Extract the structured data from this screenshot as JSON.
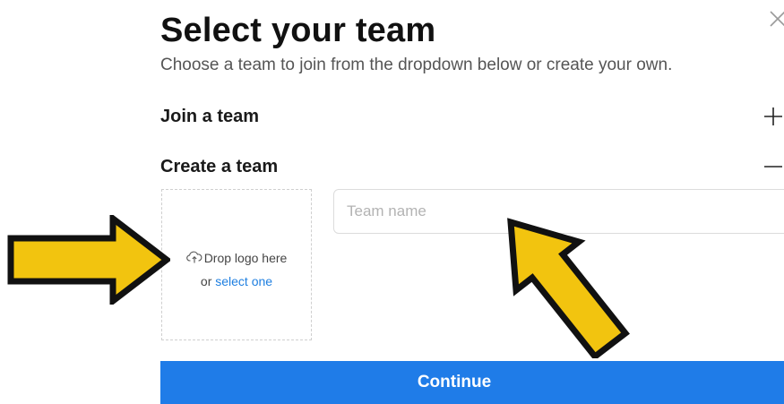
{
  "dialog": {
    "title": "Select your team",
    "subtitle": "Choose a team to join from the dropdown below or create your own."
  },
  "sections": {
    "join": {
      "label": "Join a team",
      "toggle_icon": "plus-icon"
    },
    "create": {
      "label": "Create a team",
      "toggle_icon": "minus-icon"
    }
  },
  "logo_dropzone": {
    "icon": "cloud-upload-icon",
    "drop_text": "Drop logo here",
    "or_text": "or",
    "select_link": "select one"
  },
  "team_name_input": {
    "value": "",
    "placeholder": "Team name"
  },
  "continue_button": {
    "label": "Continue"
  },
  "annotations": {
    "arrow_color": "#f2c40f",
    "arrow_outline": "#111111",
    "targets": [
      "logo-dropzone",
      "team-name-input"
    ]
  },
  "colors": {
    "accent": "#1f7ce8",
    "link": "#1f7fe0",
    "title": "#111111",
    "subtitle": "#555555"
  }
}
